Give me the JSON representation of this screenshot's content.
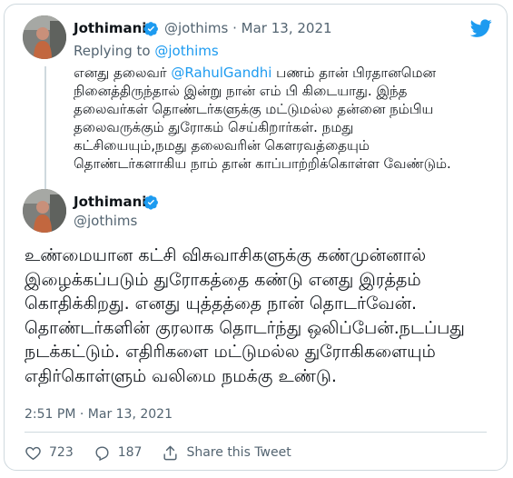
{
  "quoted_tweet": {
    "display_name": "Jothimani",
    "handle": "@jothims",
    "separator": "·",
    "date": "Mar 13, 2021",
    "replying_prefix": "Replying to ",
    "replying_handle": "@jothims",
    "text_before_mention": "எனது தலைவர் ",
    "mention": "@RahulGandhi",
    "text_after_mention": " பணம் தான் பிரதானமென நினைத்திருந்தால் இன்று நான் எம் பி கிடையாது. இந்த தலைவர்கள் தொண்டர்களுக்கு மட்டுமல்ல தன்னை நம்பிய தலைவருக்கும் துரோகம் செய்கிறார்கள். நமது கட்சியையும்,நமது தலைவரின் கௌரவத்தையும் தொண்டர்களாகிய நாம் தான் காப்பாற்றிக்கொள்ள வேண்டும்."
  },
  "tweet": {
    "display_name": "Jothimani",
    "handle": "@jothims",
    "text": "உண்மையான கட்சி விசுவாசிகளுக்கு கண்முன்னால் இழைக்கப்படும் துரோகத்தை கண்டு எனது இரத்தம் கொதிக்கிறது. எனது யுத்தத்தை நான் தொடர்வேன். தொண்டர்களின் குரலாக தொடர்ந்து ஒலிப்பேன்.நடப்பது நடக்கட்டும். எதிரிகளை மட்டுமல்ல துரோகிகளையும் எதிர்கொள்ளும் வலிமை நமக்கு உண்டு.",
    "time": "2:51 PM",
    "separator": "·",
    "date": "Mar 13, 2021",
    "likes": "723",
    "replies": "187",
    "share_label": "Share this Tweet"
  },
  "icons": {
    "brand": "twitter-bird-icon",
    "verified": "verified-badge-icon",
    "like": "heart-icon",
    "reply": "reply-bubble-icon",
    "share": "share-icon"
  },
  "colors": {
    "brand_blue": "#1d9bf0",
    "text": "#0f1419",
    "secondary": "#536471",
    "border": "#cfd9de"
  }
}
